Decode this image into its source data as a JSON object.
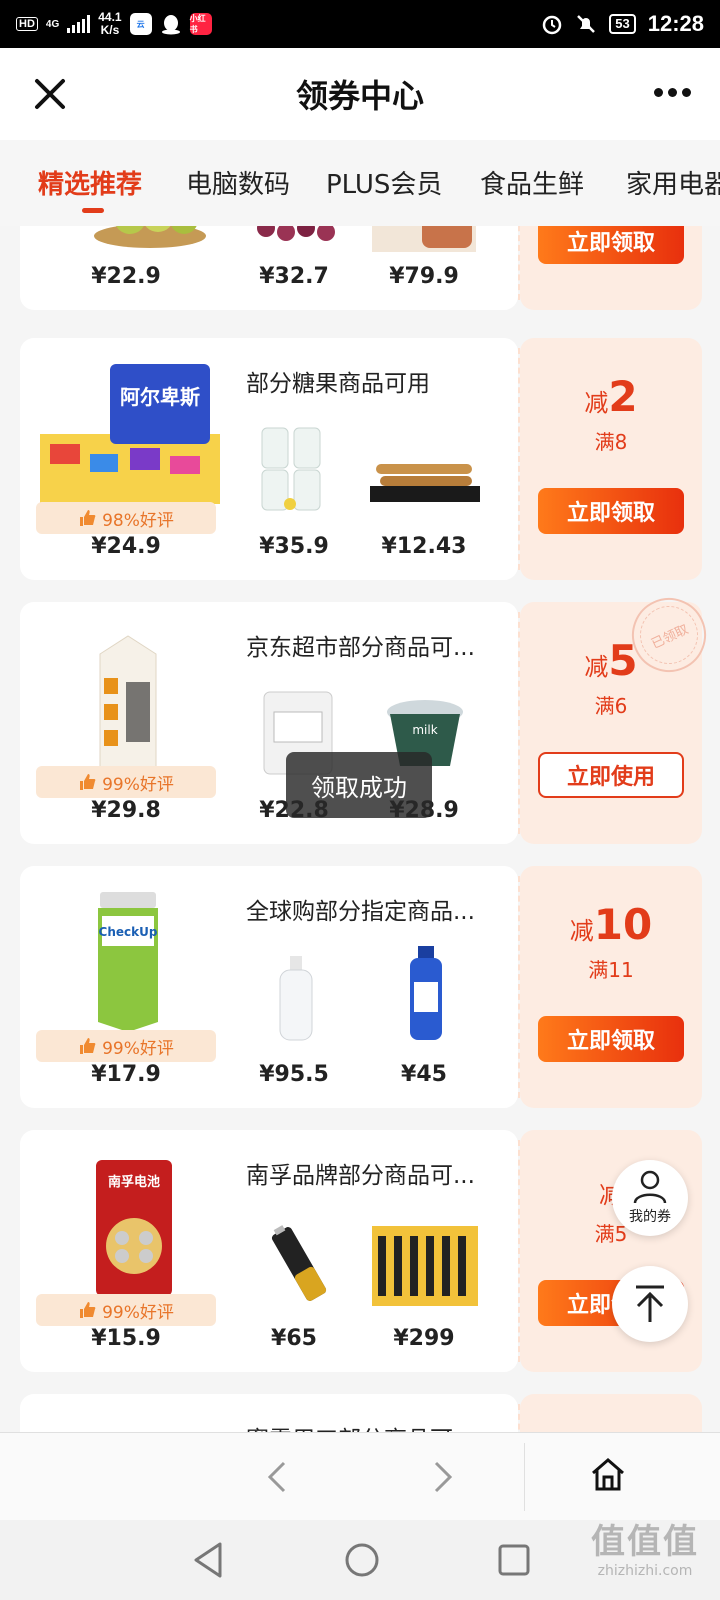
{
  "status_bar": {
    "hd": "HD",
    "network": "4G",
    "speed_value": "44.1",
    "speed_unit": "K/s",
    "app_badge": "小红书",
    "battery": "53",
    "time": "12:28"
  },
  "header": {
    "title": "领券中心"
  },
  "tabs": [
    {
      "label": "精选推荐",
      "active": true
    },
    {
      "label": "电脑数码"
    },
    {
      "label": "PLUS会员"
    },
    {
      "label": "食品生鲜"
    },
    {
      "label": "家用电器"
    }
  ],
  "cards": [
    {
      "condition": "",
      "rating": "",
      "prices": [
        "¥22.9",
        "¥32.7",
        "¥79.9"
      ],
      "discount_prefix": "",
      "discount_amount": "",
      "min_spend": "",
      "button": "立即领取"
    },
    {
      "condition": "部分糖果商品可用",
      "rating": "98%好评",
      "prices": [
        "¥24.9",
        "¥35.9",
        "¥12.43"
      ],
      "discount_prefix": "减",
      "discount_amount": "2",
      "min_spend": "满8",
      "button": "立即领取"
    },
    {
      "condition": "京东超市部分商品可...",
      "rating": "99%好评",
      "prices": [
        "¥29.8",
        "¥22.8",
        "¥28.9"
      ],
      "discount_prefix": "减",
      "discount_amount": "5",
      "min_spend": "满6",
      "button": "立即使用",
      "stamp": "已领取"
    },
    {
      "condition": "全球购部分指定商品...",
      "rating": "99%好评",
      "prices": [
        "¥17.9",
        "¥95.5",
        "¥45"
      ],
      "discount_prefix": "减",
      "discount_amount": "10",
      "min_spend": "满11",
      "button": "立即领取"
    },
    {
      "condition": "南孚品牌部分商品可...",
      "rating": "99%好评",
      "prices": [
        "¥15.9",
        "¥65",
        "¥299"
      ],
      "discount_prefix": "减",
      "discount_amount": "",
      "min_spend": "满5",
      "button": "立即领取"
    },
    {
      "condition": "蜜雪用工部分商品可..."
    }
  ],
  "toast": "领取成功",
  "floating": {
    "my_coupons": "我的券"
  },
  "watermark": {
    "big": "值值值",
    "small": "zhizhizhi.com"
  },
  "colors": {
    "accent": "#e23c1a",
    "coupon_bg": "#fdece2",
    "button_gradient_start": "#ff7a1a",
    "button_gradient_end": "#e8300d"
  }
}
